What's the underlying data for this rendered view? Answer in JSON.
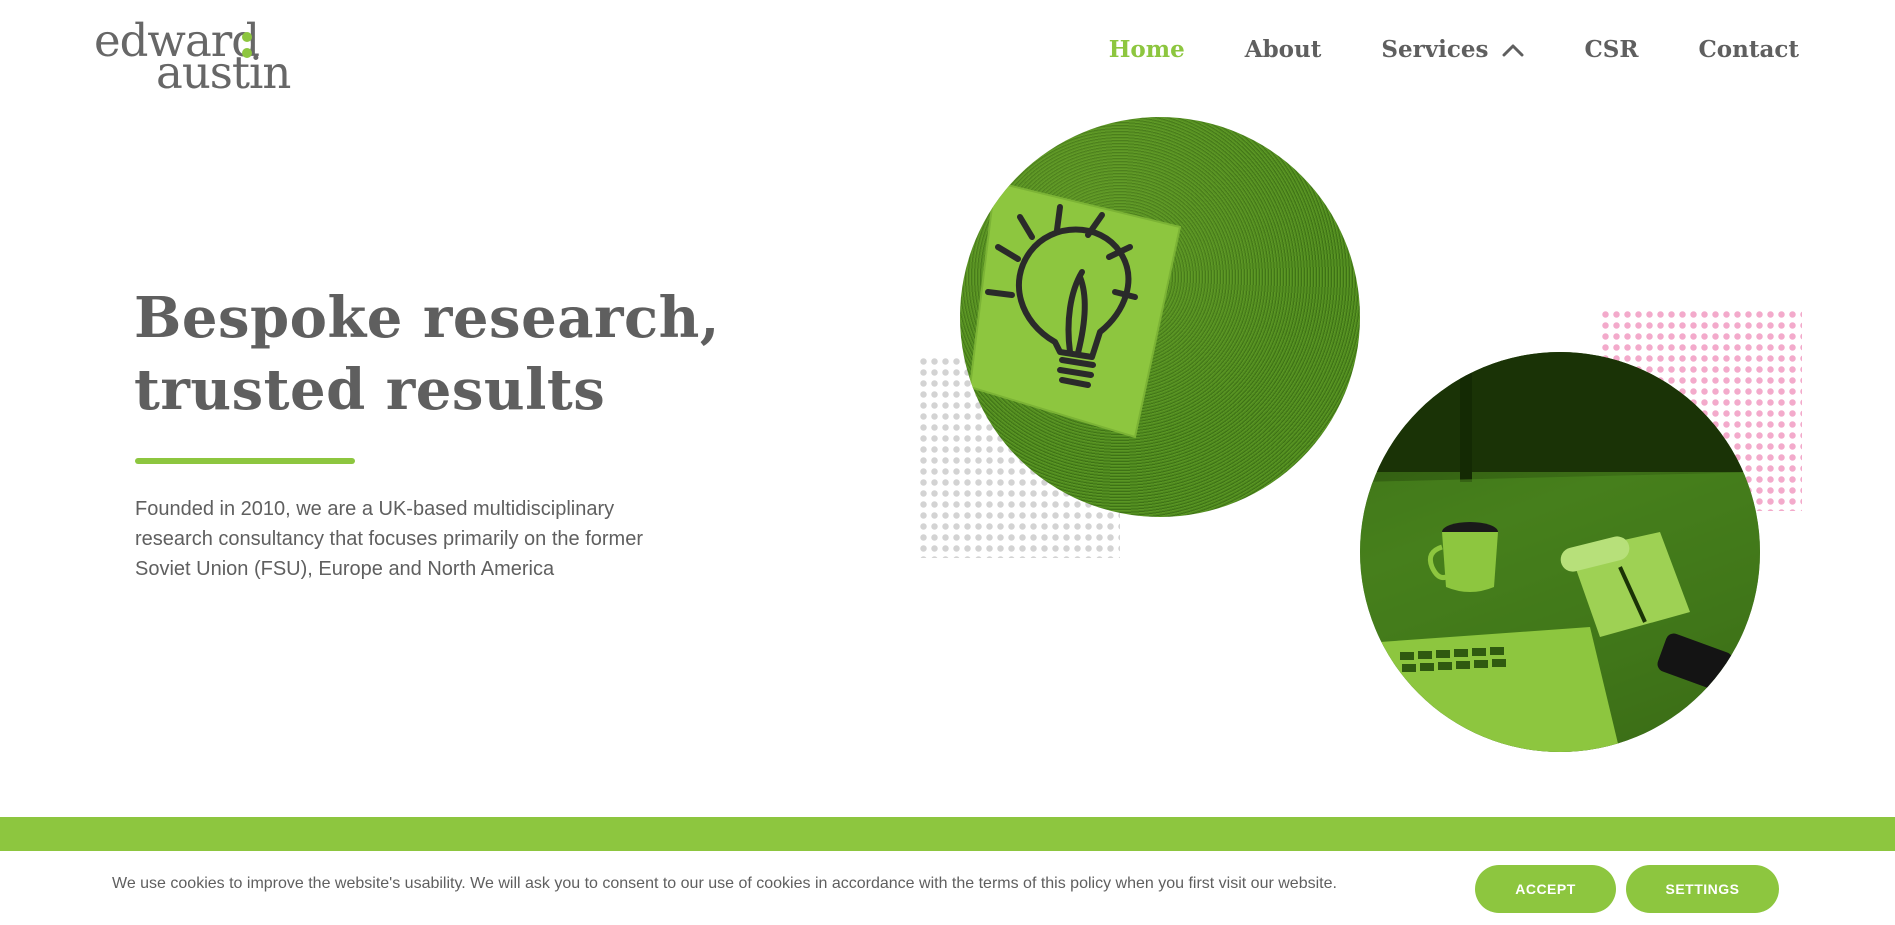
{
  "logo": {
    "line1": "edward",
    "line2": "austin"
  },
  "nav": {
    "items": [
      {
        "label": "Home",
        "active": true
      },
      {
        "label": "About"
      },
      {
        "label": "Services",
        "icon": "chevron-up-icon"
      },
      {
        "label": "CSR"
      },
      {
        "label": "Contact"
      }
    ]
  },
  "hero": {
    "title_line1": "Bespoke research,",
    "title_line2": "trusted results",
    "text": "Founded in 2010, we are a UK-based multidisciplinary research consultancy that focuses primarily on the former Soviet Union (FSU), Europe and North America"
  },
  "cookie": {
    "text": "We use cookies to improve the website's usability. We will ask you to consent to our use of cookies in accordance with the terms of this policy when you first visit our website.",
    "accept_label": "ACCEPT",
    "settings_label": "SETTINGS"
  },
  "colors": {
    "brand_green": "#8dc63f",
    "text_grey": "#5f5f5f",
    "dots_grey": "#d3d3d3",
    "dots_pink": "#f3aacb"
  }
}
